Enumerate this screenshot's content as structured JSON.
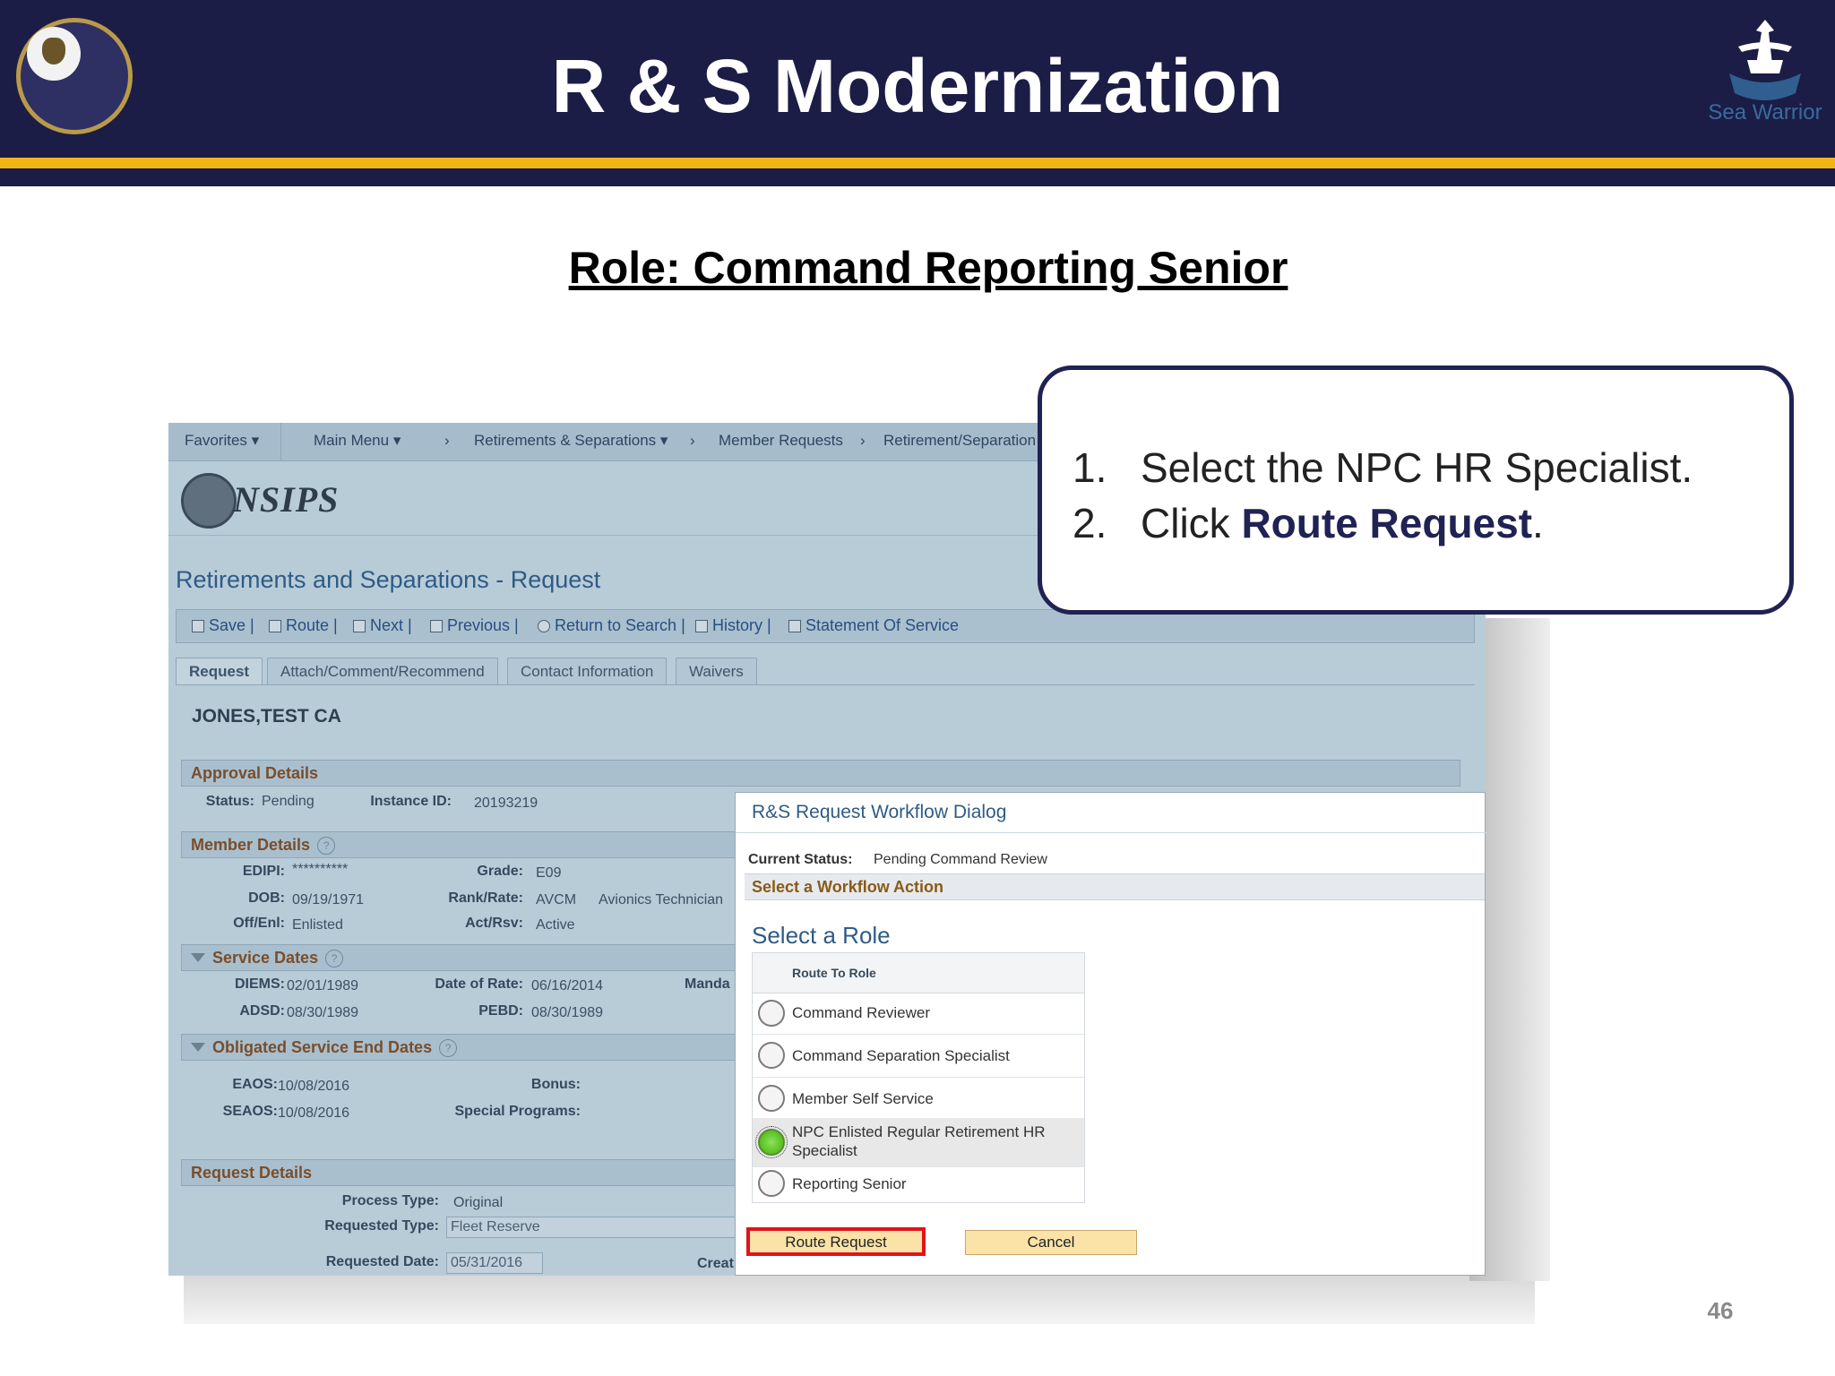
{
  "slide": {
    "title": "R & S Modernization",
    "role_heading": "Role: Command Reporting Senior",
    "page_number": "46",
    "logo_right_text": "Sea Warrior"
  },
  "app": {
    "nav": {
      "favorites": "Favorites",
      "main_menu": "Main Menu",
      "retirements": "Retirements & Separations",
      "member_requests": "Member Requests",
      "retirement_sep": "Retirement/Separation"
    },
    "logo_text": "NSIPS",
    "page_title": "Retirements and Separations - Request",
    "toolbar": {
      "save": "Save",
      "route": "Route",
      "next": "Next",
      "previous": "Previous",
      "return": "Return to Search",
      "history": "History",
      "statement": "Statement Of Service"
    },
    "tabs": [
      "Request",
      "Attach/Comment/Recommend",
      "Contact Information",
      "Waivers"
    ],
    "member_name": "JONES,TEST CA",
    "approval": {
      "header": "Approval Details",
      "status_label": "Status:",
      "status_value": "Pending",
      "instance_label": "Instance ID:",
      "instance_value": "20193219"
    },
    "member": {
      "header": "Member Details",
      "edipi_label": "EDIPI:",
      "edipi_value": "**********",
      "grade_label": "Grade:",
      "grade_value": "E09",
      "dob_label": "DOB:",
      "dob_value": "09/19/1971",
      "rank_label": "Rank/Rate:",
      "rank_value": "AVCM",
      "rank_desc": "Avionics Technician",
      "offenl_label": "Off/Enl:",
      "offenl_value": "Enlisted",
      "actrsv_label": "Act/Rsv:",
      "actrsv_value": "Active"
    },
    "service": {
      "header": "Service Dates",
      "diems_label": "DIEMS:",
      "diems_value": "02/01/1989",
      "dor_label": "Date of Rate:",
      "dor_value": "06/16/2014",
      "manda_label": "Manda",
      "adsd_label": "ADSD:",
      "adsd_value": "08/30/1989",
      "pebd_label": "PEBD:",
      "pebd_value": "08/30/1989"
    },
    "obligated": {
      "header": "Obligated Service End Dates",
      "eaos_label": "EAOS:",
      "eaos_value": "10/08/2016",
      "bonus_label": "Bonus:",
      "seaos_label": "SEAOS:",
      "seaos_value": "10/08/2016",
      "special_label": "Special Programs:"
    },
    "request": {
      "header": "Request Details",
      "process_label": "Process Type:",
      "process_value": "Original",
      "requested_type_label": "Requested Type:",
      "requested_type_value": "Fleet Reserve",
      "requested_date_label": "Requested Date:",
      "requested_date_value": "05/31/2016",
      "creat_label": "Creat"
    }
  },
  "dialog": {
    "title": "R&S Request Workflow Dialog",
    "status_label": "Current Status:",
    "status_value": "Pending Command Review",
    "action_header": "Select a Workflow Action",
    "role_title": "Select a Role",
    "grid_header": "Route To Role",
    "roles": [
      {
        "label": "Command Reviewer",
        "selected": false
      },
      {
        "label": "Command Separation Specialist",
        "selected": false
      },
      {
        "label": "Member Self Service",
        "selected": false
      },
      {
        "label": "NPC Enlisted Regular Retirement HR Specialist",
        "selected": true
      },
      {
        "label": "Reporting Senior",
        "selected": false
      }
    ],
    "route_button": "Route Request",
    "cancel_button": "Cancel"
  },
  "callout": {
    "step1_num": "1.",
    "step1_text": "Select the NPC HR Specialist.",
    "step2_num": "2.",
    "step2_prefix": "Click ",
    "step2_bold": "Route Request",
    "step2_suffix": "."
  },
  "colors": {
    "header_navy": "#1b1d46",
    "header_gold": "#f3b516",
    "highlight_red": "#e0141a",
    "selected_green": "#55c21e"
  }
}
